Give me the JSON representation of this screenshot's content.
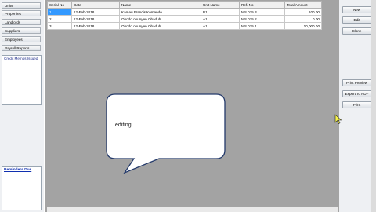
{
  "nav": {
    "items": [
      "Units",
      "Properties",
      "Landlords",
      "Suppliers",
      "Employees",
      "Payroll Reports"
    ],
    "memos_title": "Credit Memos Issued",
    "reminders_title": "Reminders Due"
  },
  "grid": {
    "columns": [
      "Serial No",
      "Date",
      "Name",
      "Unit Name",
      "Ref. No",
      "Total Amount"
    ],
    "rows": [
      [
        "1",
        "12-Feb-2018",
        "Kamau Francis Komando",
        "B1",
        "MS 015 3",
        "100.00"
      ],
      [
        "2",
        "12-Feb-2018",
        "Obodo onunyen Obaduh",
        "A1",
        "MS 015 2",
        "0.00"
      ],
      [
        "3",
        "12-Feb-2018",
        "Obodo onunyen Obaduh",
        "A1",
        "MS 015 1",
        "10,000.00"
      ]
    ],
    "selected_row": 0
  },
  "actions": {
    "new": "New",
    "edit": "Edit",
    "clone": "Clone",
    "print_preview": "Print Preview",
    "export_pdf": "Export To PDF",
    "print": "Print"
  },
  "callout": {
    "text": "editing"
  },
  "colors": {
    "selection": "#3399ff",
    "grid_background": "#a3a3a3",
    "link": "#1030b0"
  }
}
